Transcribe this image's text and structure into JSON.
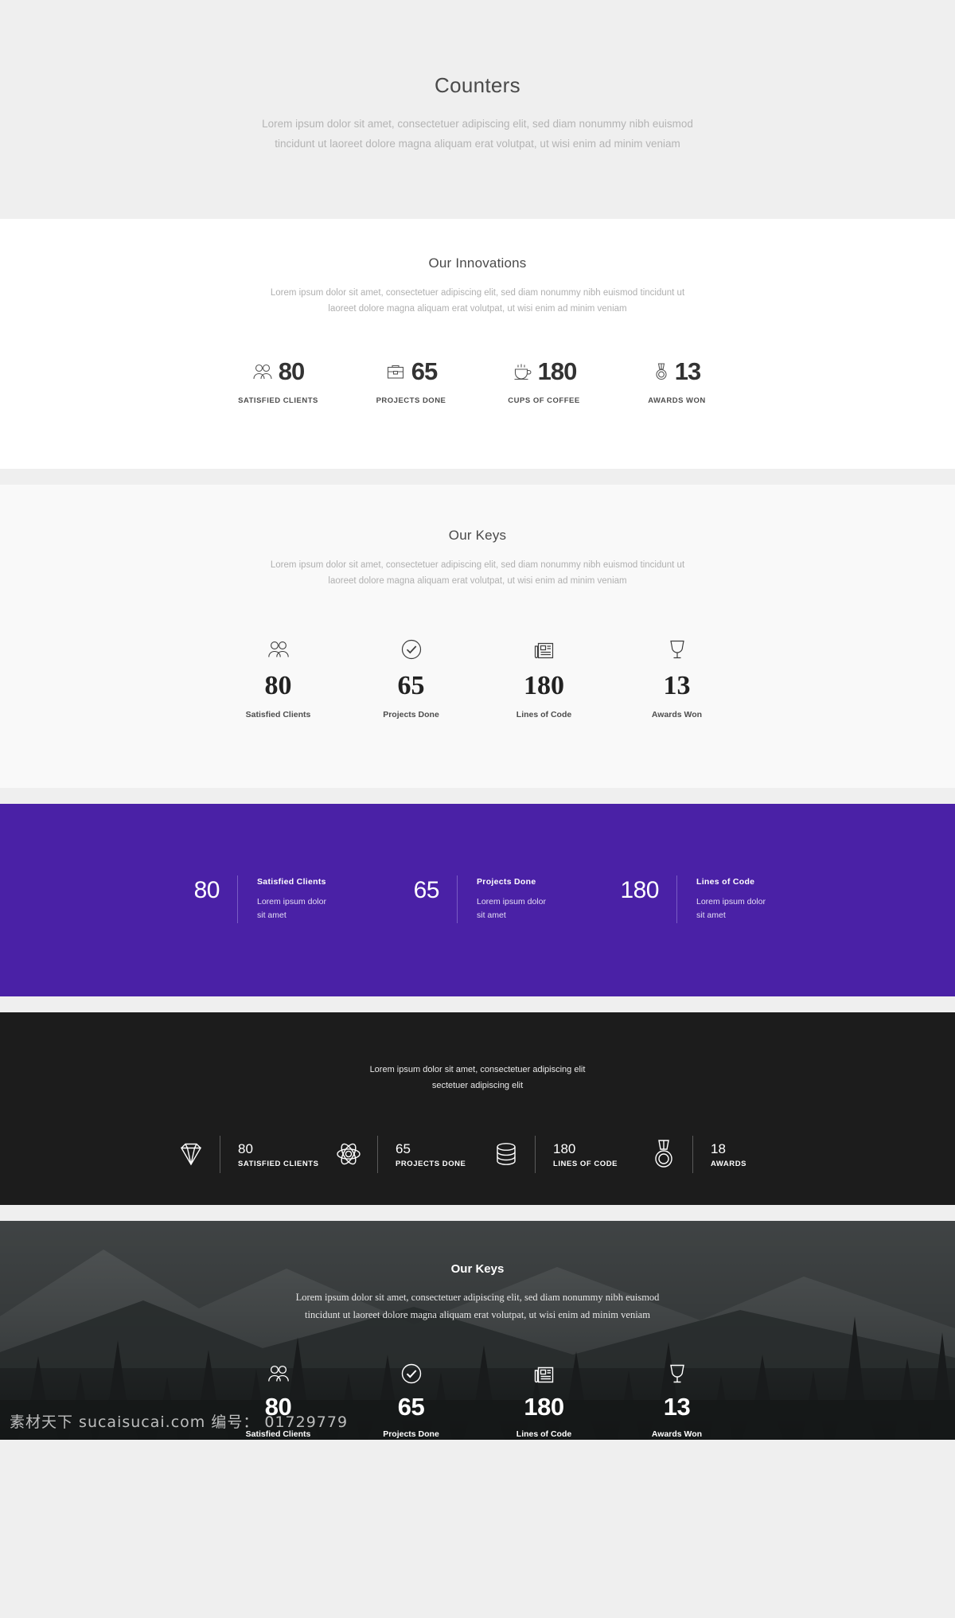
{
  "hero": {
    "title": "Counters",
    "sub_line1": "Lorem ipsum dolor sit amet, consectetuer adipiscing elit, sed diam nonummy nibh euismod",
    "sub_line2": "tincidunt ut laoreet dolore magna aliquam erat volutpat, ut wisi enim ad minim veniam"
  },
  "innovations": {
    "title": "Our Innovations",
    "sub_line1": "Lorem ipsum dolor sit amet, consectetuer adipiscing elit, sed diam nonummy nibh euismod tincidunt ut",
    "sub_line2": "laoreet dolore magna aliquam erat volutpat, ut wisi enim ad minim veniam",
    "counters": [
      {
        "icon": "users-icon",
        "value": "80",
        "label": "SATISFIED CLIENTS"
      },
      {
        "icon": "briefcase-icon",
        "value": "65",
        "label": "PROJECTS DONE"
      },
      {
        "icon": "coffee-cup-icon",
        "value": "180",
        "label": "CUPS OF COFFEE"
      },
      {
        "icon": "medal-icon",
        "value": "13",
        "label": "AWARDS WON"
      }
    ]
  },
  "keys_light": {
    "title": "Our Keys",
    "sub_line1": "Lorem ipsum dolor sit amet, consectetuer adipiscing elit, sed diam nonummy nibh euismod tincidunt ut",
    "sub_line2": "laoreet dolore magna aliquam erat volutpat, ut wisi enim ad minim veniam",
    "counters": [
      {
        "icon": "users-icon",
        "value": "80",
        "label": "Satisfied Clients"
      },
      {
        "icon": "check-circle-icon",
        "value": "65",
        "label": "Projects Done"
      },
      {
        "icon": "newspaper-icon",
        "value": "180",
        "label": "Lines of Code"
      },
      {
        "icon": "trophy-icon",
        "value": "13",
        "label": "Awards Won"
      }
    ]
  },
  "purple_band": {
    "background_color": "#4a21a6",
    "counters": [
      {
        "value": "80",
        "title": "Satisfied Clients",
        "desc_line1": "Lorem ipsum dolor",
        "desc_line2": "sit amet"
      },
      {
        "value": "65",
        "title": "Projects Done",
        "desc_line1": "Lorem ipsum dolor",
        "desc_line2": "sit amet"
      },
      {
        "value": "180",
        "title": "Lines of Code",
        "desc_line1": "Lorem ipsum dolor",
        "desc_line2": "sit amet"
      }
    ]
  },
  "dark_band": {
    "background_color": "#1c1c1c",
    "sub_line1": "Lorem ipsum dolor sit amet, consectetuer adipiscing elit",
    "sub_line2": "sectetuer adipiscing elit",
    "counters": [
      {
        "icon": "diamond-icon",
        "value": "80",
        "label": "SATISFIED CLIENTS"
      },
      {
        "icon": "atom-icon",
        "value": "65",
        "label": "PROJECTS DONE"
      },
      {
        "icon": "database-icon",
        "value": "180",
        "label": "LINES OF CODE"
      },
      {
        "icon": "medal-icon",
        "value": "18",
        "label": "AWARDS"
      }
    ]
  },
  "photo_band": {
    "title": "Our Keys",
    "sub_line1": "Lorem ipsum dolor sit amet, consectetuer adipiscing elit, sed diam nonummy nibh euismod",
    "sub_line2": "tincidunt ut laoreet dolore magna aliquam erat volutpat, ut wisi enim ad minim veniam",
    "counters": [
      {
        "icon": "users-icon",
        "value": "80",
        "label": "Satisfied Clients"
      },
      {
        "icon": "check-circle-icon",
        "value": "65",
        "label": "Projects Done"
      },
      {
        "icon": "newspaper-icon",
        "value": "180",
        "label": "Lines of Code"
      },
      {
        "icon": "trophy-icon",
        "value": "13",
        "label": "Awards Won"
      }
    ]
  },
  "watermark": "素材天下 sucaisucai.com  编号： 01729779"
}
